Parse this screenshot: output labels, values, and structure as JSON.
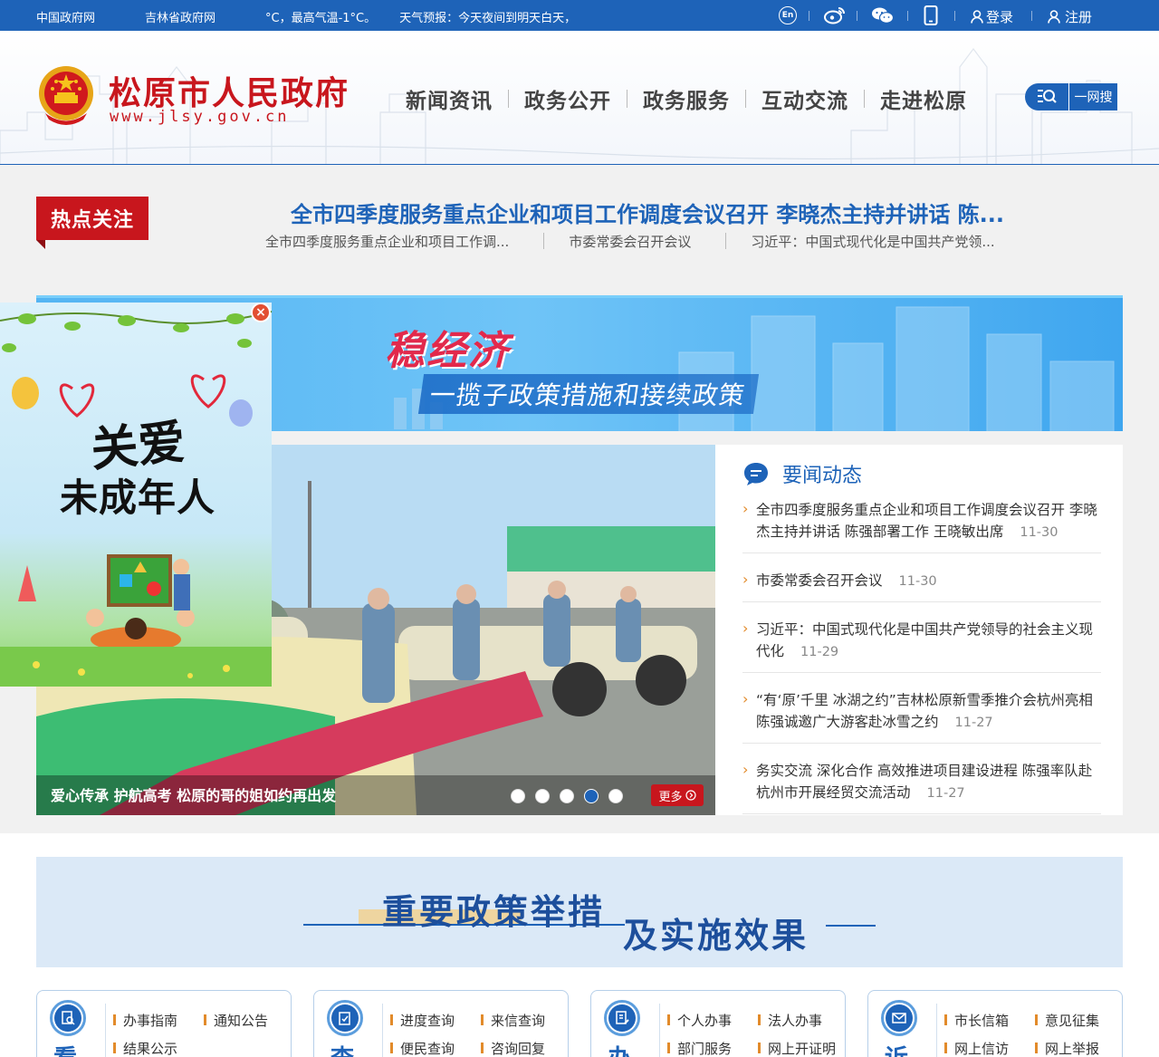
{
  "topbar": {
    "links": [
      "中国政府网",
      "吉林省政府网"
    ],
    "weather": [
      "°C，最高气温-1°C。",
      "天气预报：今天夜间到明天白天，"
    ],
    "en_label": "En",
    "login": "登录",
    "register": "注册"
  },
  "header": {
    "site_title": "松原市人民政府",
    "site_url": "www.jlsy.gov.cn",
    "nav": [
      "新闻资讯",
      "政务公开",
      "政务服务",
      "互动交流",
      "走进松原"
    ],
    "search_label": "一网搜"
  },
  "hot": {
    "badge": "热点关注",
    "title": "全市四季度服务重点企业和项目工作调度会议召开 李晓杰主持并讲话 陈...",
    "subs": [
      "全市四季度服务重点企业和项目工作调...",
      "市委常委会召开会议",
      "习近平：中国式现代化是中国共产党领..."
    ]
  },
  "banner": {
    "title": "稳经济",
    "subtitle": "一揽子政策措施和接续政策"
  },
  "slider": {
    "caption": "爱心传承 护航高考 松原的哥的姐如约再出发",
    "more": "更多",
    "dots": 5,
    "active_dot": 3
  },
  "news": {
    "title": "要闻动态",
    "items": [
      {
        "text": "全市四季度服务重点企业和项目工作调度会议召开 李晓杰主持并讲话 陈强部署工作 王晓敏出席",
        "date": "11-30"
      },
      {
        "text": "市委常委会召开会议",
        "date": "11-30"
      },
      {
        "text": "习近平：中国式现代化是中国共产党领导的社会主义现代化",
        "date": "11-29"
      },
      {
        "text": "“有‘原’千里 冰湖之约”吉林松原新雪季推介会杭州亮相 陈强诚邀广大游客赴冰雪之约",
        "date": "11-27"
      },
      {
        "text": "务实交流 深化合作 高效推进项目建设进程 陈强率队赴杭州市开展经贸交流活动",
        "date": "11-27"
      }
    ]
  },
  "popup": {
    "line1": "关爱",
    "line2": "未成年人",
    "close": "×"
  },
  "policy": {
    "part1": "重要政策举措",
    "part2": "及实施效果"
  },
  "cards": [
    {
      "big": "看",
      "links": [
        "办事指南",
        "通知公告",
        "结果公示"
      ]
    },
    {
      "big": "查",
      "links": [
        "进度查询",
        "来信查询",
        "便民查询",
        "咨询回复"
      ]
    },
    {
      "big": "办",
      "links": [
        "个人办事",
        "法人办事",
        "部门服务",
        "网上开证明"
      ]
    },
    {
      "big": "诉",
      "links": [
        "市长信箱",
        "意见征集",
        "网上信访",
        "网上举报"
      ]
    }
  ]
}
